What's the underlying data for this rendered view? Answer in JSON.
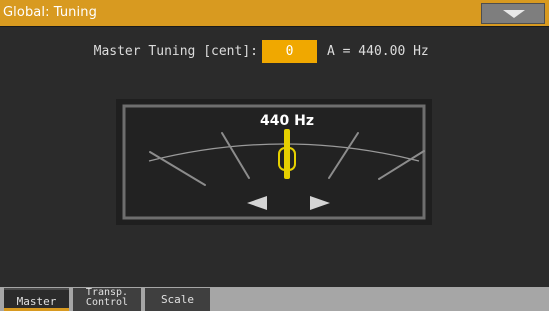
{
  "window": {
    "title": "Global: Tuning",
    "menu_icon": "triangle-down-icon",
    "accent_color": "#d89a20"
  },
  "master_tuning": {
    "label": "Master Tuning [cent]:",
    "value": "0",
    "a_frequency": "A =  440.00 Hz",
    "value_color": "#f0a800"
  },
  "tuner": {
    "frequency_label": "440 Hz",
    "needle_color": "#e6d000",
    "flat_arrow_icon": "left-triangle-icon",
    "sharp_arrow_icon": "right-triangle-icon"
  },
  "tabs": [
    {
      "label_line1": "Master",
      "label_line2": "",
      "selected": true
    },
    {
      "label_line1": "Transp.",
      "label_line2": "Control",
      "selected": false
    },
    {
      "label_line1": "Scale",
      "label_line2": "",
      "selected": false
    }
  ]
}
